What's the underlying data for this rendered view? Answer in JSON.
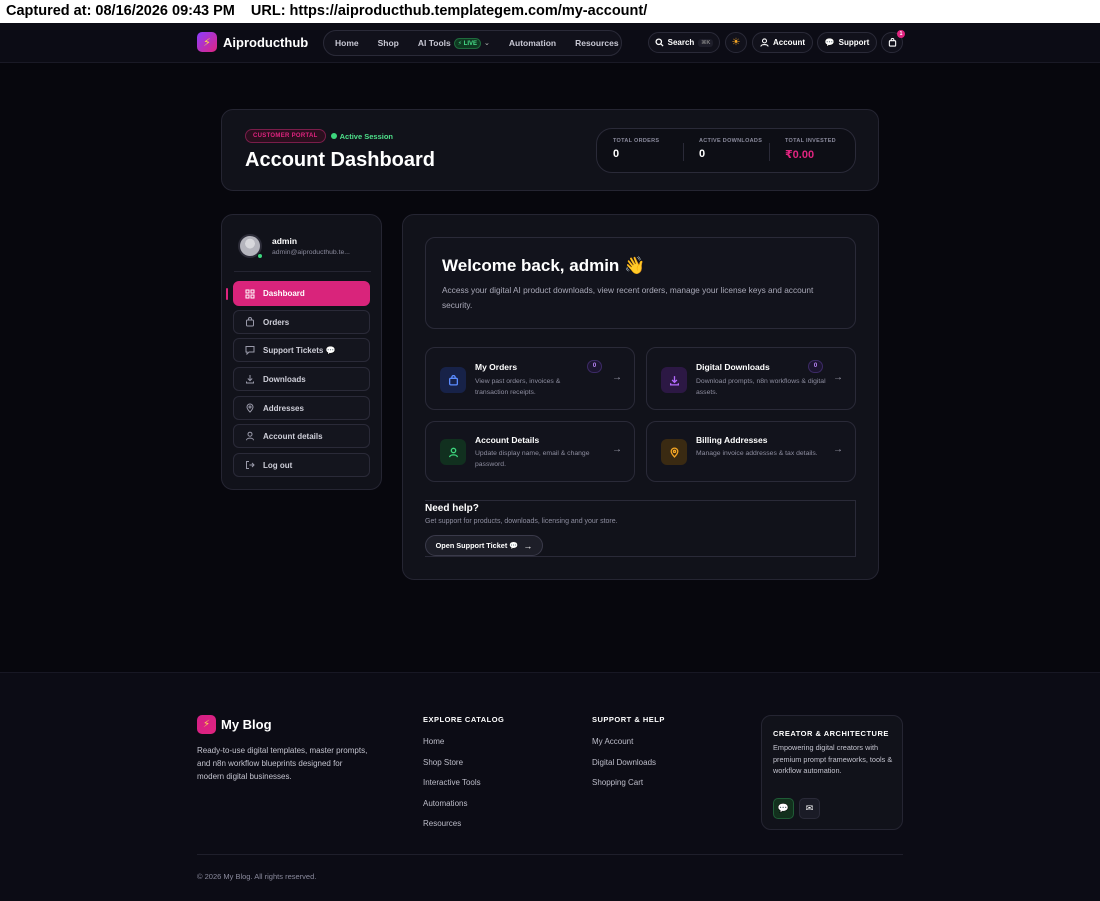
{
  "capture": {
    "captured_at": "Captured at: 08/16/2026 09:43 PM",
    "url": "URL: https://aiproducthub.templategem.com/my-account/"
  },
  "header": {
    "logo_text": "Aiproducthub",
    "nav": [
      {
        "label": "Home"
      },
      {
        "label": "Shop"
      },
      {
        "label": "AI Tools"
      },
      {
        "label": "Automation"
      },
      {
        "label": "Resources"
      }
    ],
    "live_badge": "⚡ LIVE",
    "search_label": "Search",
    "search_shortcut": "⌘K",
    "account_label": "Account",
    "support_label": "Support",
    "cart_count": "1"
  },
  "dashboard": {
    "portal_label": "CUSTOMER PORTAL",
    "session_label": "Active Session",
    "title": "Account Dashboard",
    "stats": [
      {
        "label": "TOTAL ORDERS",
        "value": "0"
      },
      {
        "label": "ACTIVE DOWNLOADS",
        "value": "0"
      },
      {
        "label": "TOTAL INVESTED",
        "value": "₹0.00"
      }
    ]
  },
  "sidebar": {
    "user_name": "admin",
    "user_email": "admin@aiproducthub.te...",
    "items": [
      {
        "label": "Dashboard"
      },
      {
        "label": "Orders"
      },
      {
        "label": "Support Tickets 💬"
      },
      {
        "label": "Downloads"
      },
      {
        "label": "Addresses"
      },
      {
        "label": "Account details"
      },
      {
        "label": "Log out"
      }
    ]
  },
  "welcome": {
    "title": "Welcome back, admin 👋",
    "text": "Access your digital AI product downloads, view recent orders, manage your license keys and account security."
  },
  "tiles": [
    {
      "title": "My Orders",
      "desc": "View past orders, invoices & transaction receipts.",
      "count": "0",
      "icon": "shopping-bag-icon",
      "color": "#3b82f6"
    },
    {
      "title": "Digital Downloads",
      "desc": "Download prompts, n8n workflows & digital assets.",
      "count": "0",
      "icon": "download-icon",
      "color": "#a855f7"
    },
    {
      "title": "Account Details",
      "desc": "Update display name, email & change password.",
      "icon": "user-icon",
      "color": "#22c55e"
    },
    {
      "title": "Billing Addresses",
      "desc": "Manage invoice addresses & tax details.",
      "icon": "map-pin-icon",
      "color": "#f59e0b"
    }
  ],
  "help": {
    "title": "Need help?",
    "text": "Get support for products, downloads, licensing and your store.",
    "button": "Open Support Ticket 💬"
  },
  "footer": {
    "brand": "My Blog",
    "tagline": "Ready-to-use digital templates, master prompts, and n8n workflow blueprints designed for modern digital businesses.",
    "explore_title": "EXPLORE CATALOG",
    "explore_links": [
      {
        "label": "Home"
      },
      {
        "label": "Shop Store"
      },
      {
        "label": "Interactive Tools"
      },
      {
        "label": "Automations"
      },
      {
        "label": "Resources"
      }
    ],
    "support_title": "SUPPORT & HELP",
    "support_links": [
      {
        "label": "My Account"
      },
      {
        "label": "Digital Downloads"
      },
      {
        "label": "Shopping Cart"
      }
    ],
    "creator_title": "CREATOR & ARCHITECTURE",
    "creator_text": "Empowering digital creators with premium prompt frameworks, tools & workflow automation.",
    "copyright": "© 2026 My Blog. All rights reserved."
  }
}
